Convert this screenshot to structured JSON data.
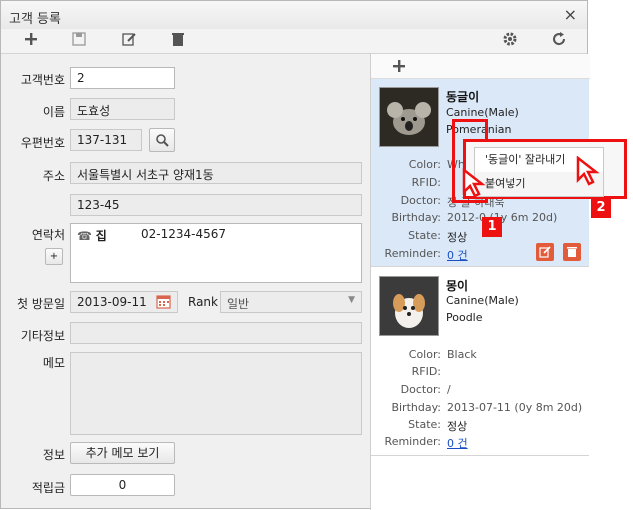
{
  "window": {
    "title": "고객 등록",
    "close_glyph": "×"
  },
  "toolbar": {
    "add": "plus-icon",
    "save": "save-icon",
    "edit": "edit-icon",
    "delete": "trash-icon",
    "settings": "gear-icon",
    "refresh": "refresh-icon"
  },
  "form": {
    "customer_no_label": "고객번호",
    "customer_no": "2",
    "name_label": "이름",
    "name": "도효성",
    "zip_label": "우편번호",
    "zip": "137-131",
    "address_label": "주소",
    "address1": "서울특별시 서초구 양재1동",
    "address2": "123-45",
    "contact_label": "연락처",
    "contact_type": "집",
    "contact_phone": "02-1234-4567",
    "contact_add_label": "+",
    "first_visit_label": "첫 방문일",
    "first_visit": "2013-09-11",
    "rank_label": "Rank",
    "rank_value": "일반",
    "etc_label": "기타정보",
    "memo_label": "메모",
    "info_label": "정보",
    "more_memo_button": "추가 메모 보기",
    "points_label": "적립금",
    "points": "0"
  },
  "pets": [
    {
      "name": "동글이",
      "species": "Canine(Male)",
      "breed": "Pomeranian",
      "color_label": "Color:",
      "color": "Wh",
      "rfid_label": "RFID:",
      "rfid": "",
      "doctor_label": "Doctor:",
      "doctor": "정 글 하대욱",
      "birthday_label": "Birthday:",
      "birthday": "2012-0    (1y 6m 20d)",
      "state_label": "State:",
      "state": "정상",
      "reminder_label": "Reminder:",
      "reminder": "0 건"
    },
    {
      "name": "몽이",
      "species": "Canine(Male)",
      "breed": "Poodle",
      "color_label": "Color:",
      "color": "Black",
      "rfid_label": "RFID:",
      "rfid": "",
      "doctor_label": "Doctor:",
      "doctor": "/",
      "birthday_label": "Birthday:",
      "birthday": "2013-07-11 (0y 8m 20d)",
      "state_label": "State:",
      "state": "정상",
      "reminder_label": "Reminder:",
      "reminder": "0 건"
    }
  ],
  "context_menu": {
    "cut": "'동글이' 잘라내기",
    "paste": "붙여넣기"
  },
  "callouts": {
    "one": "1",
    "two": "2"
  },
  "colors": {
    "accent_red": "#e11111",
    "selected_card": "#dbe8f8",
    "link": "#1a4fc4"
  }
}
